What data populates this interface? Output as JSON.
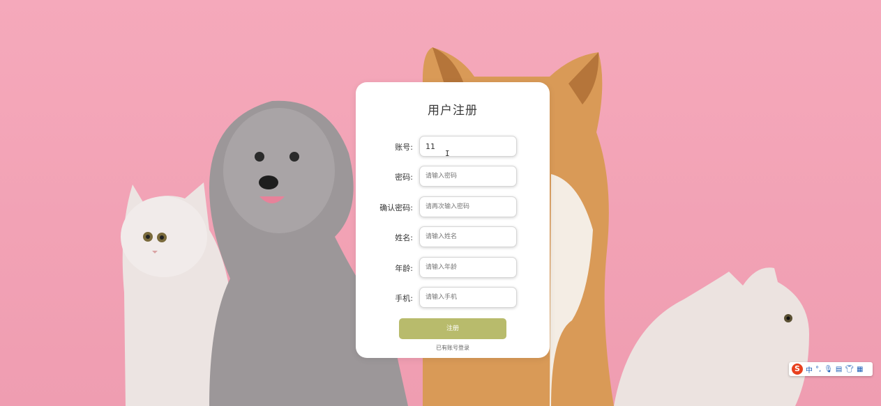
{
  "form": {
    "title": "用户注册",
    "fields": [
      {
        "label": "账号:",
        "value": "11",
        "placeholder": ""
      },
      {
        "label": "密码:",
        "value": "",
        "placeholder": "请输入密码"
      },
      {
        "label": "确认密码:",
        "value": "",
        "placeholder": "请再次输入密码"
      },
      {
        "label": "姓名:",
        "value": "",
        "placeholder": "请输入姓名"
      },
      {
        "label": "年龄:",
        "value": "",
        "placeholder": "请输入年龄"
      },
      {
        "label": "手机:",
        "value": "",
        "placeholder": "请输入手机"
      }
    ],
    "submit_label": "注册",
    "login_link": "已有账号登录"
  },
  "ime_toolbar": {
    "logo": "S",
    "mode": "中",
    "icons": [
      "punctuation-icon",
      "microphone-icon",
      "keyboard-icon",
      "skin-icon",
      "toolbox-icon"
    ]
  },
  "colors": {
    "background": "#f3a6b8",
    "card": "#ffffff",
    "submit_button": "#b8bb6c",
    "ime_logo": "#e8411f"
  }
}
